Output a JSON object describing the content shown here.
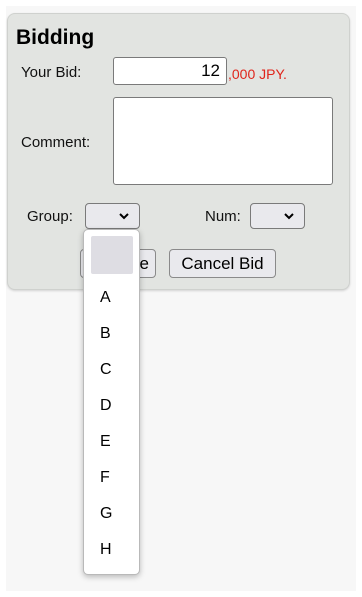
{
  "bidding": {
    "title": "Bidding",
    "your_bid_label": "Your Bid:",
    "bid_value": "12",
    "bid_suffix": ",000 JPY.",
    "comment_label": "Comment:",
    "comment_value": "",
    "group_label": "Group:",
    "group_selected": "",
    "num_label": "Num:",
    "num_selected": "",
    "left_button_partial_label": "e",
    "cancel_button_label": "Cancel Bid"
  },
  "group_dropdown": {
    "options": [
      "",
      "A",
      "B",
      "C",
      "D",
      "E",
      "F",
      "G",
      "H"
    ]
  },
  "colors": {
    "suffix_red": "#e0251b",
    "panel_bg": "#e2e4e1",
    "highlight": "#dedde3"
  }
}
